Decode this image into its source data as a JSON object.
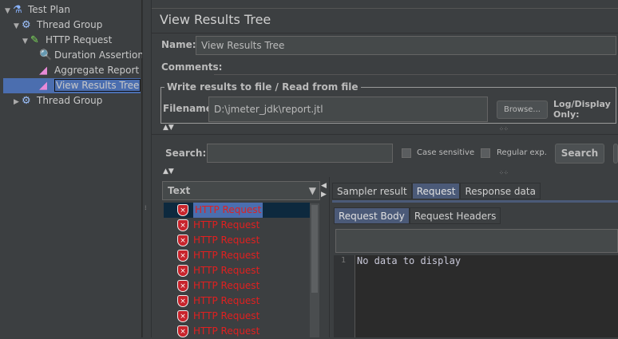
{
  "tree": [
    {
      "label": "Test Plan",
      "icon": "flask-icon",
      "level": 0,
      "expanded": true
    },
    {
      "label": "Thread Group",
      "icon": "gear-icon",
      "level": 1,
      "expanded": true
    },
    {
      "label": "HTTP Request",
      "icon": "pipette-icon",
      "level": 2,
      "expanded": true
    },
    {
      "label": "Duration Assertion",
      "icon": "magnifier-icon",
      "level": 3
    },
    {
      "label": "Aggregate Report",
      "icon": "chart-icon",
      "level": 3
    },
    {
      "label": "View Results Tree",
      "icon": "chart-icon",
      "level": 3,
      "selected": true
    },
    {
      "label": "Thread Group",
      "icon": "gear-icon",
      "level": 1,
      "expanded": false
    }
  ],
  "panel": {
    "title": "View Results Tree",
    "name_label": "Name:",
    "name_value": "View Results Tree",
    "comments_label": "Comments:",
    "file_group": "Write results to file / Read from file",
    "filename_label": "Filename",
    "filename_value": "D:\\jmeter_jdk\\report.jtl",
    "browse": "Browse...",
    "log_display": "Log/Display Only:",
    "search_label": "Search:",
    "search_value": "",
    "case_sensitive": "Case sensitive",
    "regular_exp": "Regular exp.",
    "search_button": "Search"
  },
  "results": {
    "renderer": "Text",
    "items": [
      "HTTP Request",
      "HTTP Request",
      "HTTP Request",
      "HTTP Request",
      "HTTP Request",
      "HTTP Request",
      "HTTP Request",
      "HTTP Request",
      "HTTP Request"
    ],
    "tabs": [
      "Sampler result",
      "Request",
      "Response data"
    ],
    "active_tab": "Request",
    "subtabs": [
      "Request Body",
      "Request Headers"
    ],
    "active_subtab": "Request Body",
    "line_number": "1",
    "body_text": "No data to display"
  },
  "colors": {
    "background": "#3c3f41",
    "selection": "#4b6eaf",
    "error": "#e02020",
    "editor": "#2b2b2b"
  }
}
